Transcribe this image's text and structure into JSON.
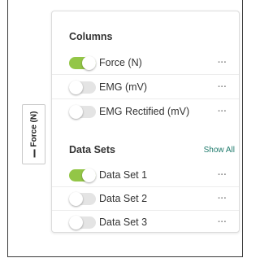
{
  "axis_tab": {
    "label": "Force (N)"
  },
  "columns": {
    "title": "Columns",
    "items": [
      {
        "label": "Force (N)",
        "enabled": true
      },
      {
        "label": "EMG (mV)",
        "enabled": false
      },
      {
        "label": "EMG Rectified (mV)",
        "enabled": false
      }
    ]
  },
  "data_sets": {
    "title": "Data Sets",
    "show_all": "Show All",
    "items": [
      {
        "label": "Data Set 1",
        "enabled": true
      },
      {
        "label": "Data Set 2",
        "enabled": false
      },
      {
        "label": "Data Set 3",
        "enabled": false
      }
    ]
  },
  "more_glyph": "···",
  "icons": {
    "more": "ellipsis-icon",
    "axis_swatch": "series-swatch-icon"
  },
  "colors": {
    "toggle_on": "#93c647",
    "toggle_off": "#e4e4e4",
    "link": "#1f7a6c"
  }
}
